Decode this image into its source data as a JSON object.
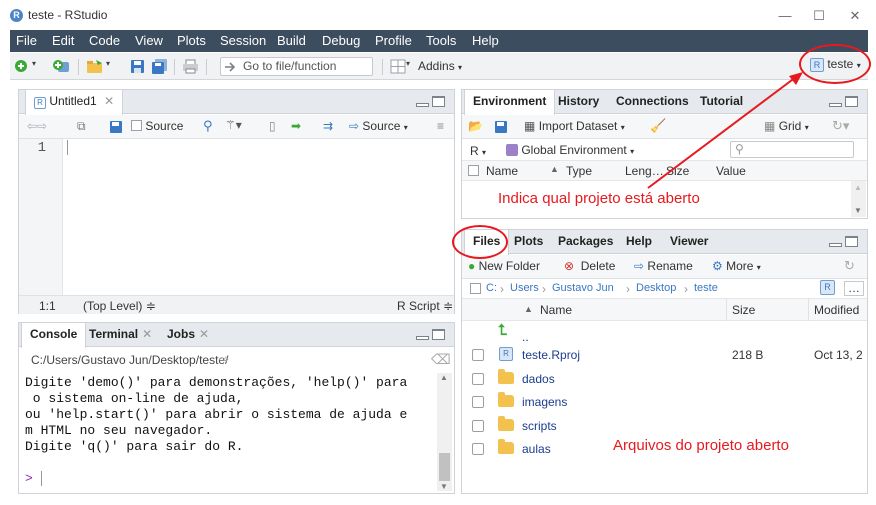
{
  "window": {
    "title": "teste - RStudio",
    "controls": [
      "—",
      "☐",
      "✕"
    ]
  },
  "menu": [
    "File",
    "Edit",
    "Code",
    "View",
    "Plots",
    "Session",
    "Build",
    "Debug",
    "Profile",
    "Tools",
    "Help"
  ],
  "toolbar": {
    "goto_placeholder": "Go to file/function",
    "addins_label": "Addins",
    "project_label": "teste"
  },
  "editor": {
    "tab_label": "Untitled1",
    "source_label": "Source",
    "source_btn_label": "Source",
    "line_number": "1",
    "status_pos": "1:1",
    "status_scope": "(Top Level) ≑",
    "status_type": "R Script ≑"
  },
  "console": {
    "tabs": [
      "Console",
      "Terminal",
      "Jobs"
    ],
    "path": "C:/Users/Gustavo Jun/Desktop/teste/",
    "lines": [
      "Digite 'demo()' para demonstrações, 'help()' para",
      " o sistema on-line de ajuda,",
      "ou 'help.start()' para abrir o sistema de ajuda e",
      "m HTML no seu navegador.",
      "Digite 'q()' para sair do R."
    ],
    "prompt": ">"
  },
  "environment": {
    "tabs": [
      "Environment",
      "History",
      "Connections",
      "Tutorial"
    ],
    "import_label": "Import Dataset",
    "grid_label": "Grid",
    "r_label": "R",
    "global_env_label": "Global Environment",
    "columns": [
      "Name",
      "Type",
      "Leng…",
      "Size",
      "Value"
    ]
  },
  "files": {
    "tabs": [
      "Files",
      "Plots",
      "Packages",
      "Help",
      "Viewer"
    ],
    "new_folder_label": "New Folder",
    "delete_label": "Delete",
    "rename_label": "Rename",
    "more_label": "More",
    "breadcrumb": [
      "C:",
      "Users",
      "Gustavo Jun",
      "Desktop",
      "teste"
    ],
    "columns": [
      "Name",
      "Size",
      "Modified"
    ],
    "up_label": "..",
    "rows": [
      {
        "name": "teste.Rproj",
        "size": "218 B",
        "modified": "Oct 13, 2"
      },
      {
        "name": "dados",
        "size": "",
        "modified": ""
      },
      {
        "name": "imagens",
        "size": "",
        "modified": ""
      },
      {
        "name": "scripts",
        "size": "",
        "modified": ""
      },
      {
        "name": "aulas",
        "size": "",
        "modified": ""
      }
    ]
  },
  "annotations": {
    "project_note": "Indica qual projeto está aberto",
    "files_note": "Arquivos do projeto aberto",
    "color": "#e8191e"
  },
  "colors": {
    "menubar": "#3b4d5e",
    "accent": "#4a86c8"
  }
}
